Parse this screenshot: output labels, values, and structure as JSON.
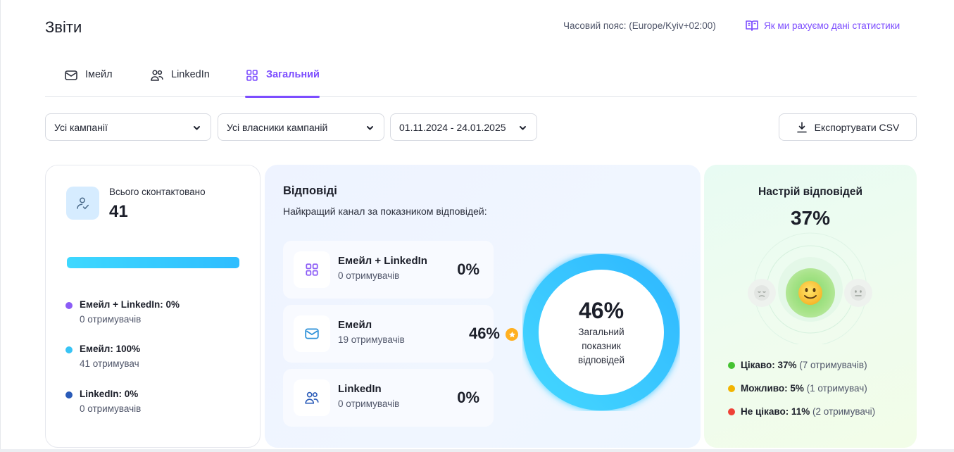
{
  "header": {
    "title": "Звіти",
    "timezone": "Часовий пояс: (Europe/Kyiv+02:00)",
    "how_link": "Як ми рахуємо дані статистики"
  },
  "tabs": [
    {
      "label": "Імейл",
      "icon": "mail-icon",
      "active": false
    },
    {
      "label": "LinkedIn",
      "icon": "users-icon",
      "active": false
    },
    {
      "label": "Загальний",
      "icon": "grid-icon",
      "active": true
    }
  ],
  "filters": {
    "campaigns": "Усі кампанії",
    "owners": "Усі власники кампаній",
    "date_range": "01.11.2024 - 24.01.2025",
    "export": "Експортувати CSV"
  },
  "contacted": {
    "label": "Всього сконтактовано",
    "value": "41",
    "legend": [
      {
        "title": "Емейл + LinkedIn: 0%",
        "sub": "0 отримувачів",
        "color": "#8b5cf6"
      },
      {
        "title": "Емейл: 100%",
        "sub": "41 отримувач",
        "color": "#38c4f5"
      },
      {
        "title": "LinkedIn: 0%",
        "sub": "0 отримувачів",
        "color": "#2a5bb8"
      }
    ]
  },
  "replies": {
    "title": "Відповіді",
    "subtitle": "Найкращий канал за показником відповідей:",
    "channels": [
      {
        "name": "Емейл + LinkedIn",
        "recipients": "0 отримувачів",
        "pct": "0%",
        "icon": "grid-icon",
        "best": false
      },
      {
        "name": "Емейл",
        "recipients": "19 отримувачів",
        "pct": "46%",
        "icon": "mail-icon",
        "best": true
      },
      {
        "name": "LinkedIn",
        "recipients": "0 отримувачів",
        "pct": "0%",
        "icon": "users-icon",
        "best": false
      }
    ],
    "overall_value": "46%",
    "overall_label": "Загальний показник відповідей",
    "overall_fraction": 1.0
  },
  "mood": {
    "title": "Настрій відповідей",
    "value": "37%",
    "legend": [
      {
        "label": "Цікаво: 37%",
        "detail": "(7 отримувачів)",
        "color": "#45c232"
      },
      {
        "label": "Можливо: 5%",
        "detail": "(1 отримувач)",
        "color": "#f2b400"
      },
      {
        "label": "Не цікаво: 11%",
        "detail": "(2 отримувачі)",
        "color": "#ef4136"
      }
    ]
  },
  "colors": {
    "accent": "#7c4dff",
    "donut": "#36c6ff"
  }
}
